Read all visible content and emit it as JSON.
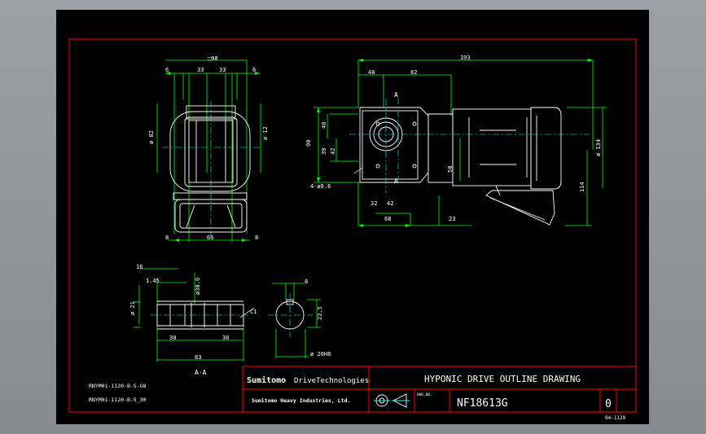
{
  "dims_front": {
    "top": "□90",
    "top_left": "6",
    "top_c1": "33",
    "top_c2": "33",
    "top_right": "6",
    "left_v": "ø 82",
    "right_v": "ø 12",
    "bot_left": "8",
    "bot_c": "66",
    "bot_right": "8"
  },
  "dims_side": {
    "overall": "393",
    "d40": "40",
    "d82": "82",
    "v90": "90",
    "v46": "46",
    "v39": "39",
    "v42": "42",
    "v50": "50",
    "d134": "ø 134",
    "d114": "114",
    "holes": "4-ø8.6",
    "b32": "32",
    "b42": "42",
    "b68": "68",
    "b23": "23",
    "section_a": "A"
  },
  "dims_section": {
    "d16": "16",
    "d145": "1.45",
    "d300": "ø30.0",
    "v21": "ø 21",
    "c1": "C1",
    "d30a": "30",
    "d30b": "30",
    "d83": "83",
    "label": "A-A"
  },
  "dims_shaft": {
    "d8": "8",
    "d225": "22.5",
    "d20h8": "ø 20H8"
  },
  "left_notes": [
    "RNYM01-1120-B-5-G8",
    "RNYM01-1120-B-5_30"
  ],
  "title_block": {
    "brand1": "Sumitomo",
    "brand2": "DriveTechnologies",
    "parent": "Sumitomo Heavy Industries, Ltd.",
    "title": "HYPONIC DRIVE OUTLINE DRAWING",
    "dwg_no_label": "DWG.NO.",
    "dwg_no": "NF18613G",
    "rev": "0",
    "sheet_note": "04-1120"
  },
  "colors": {
    "border": "#ff0000",
    "geometry": "#ffffff",
    "center": "#00ffff",
    "dimension": "#00ff00",
    "frame": "#00ff00"
  }
}
